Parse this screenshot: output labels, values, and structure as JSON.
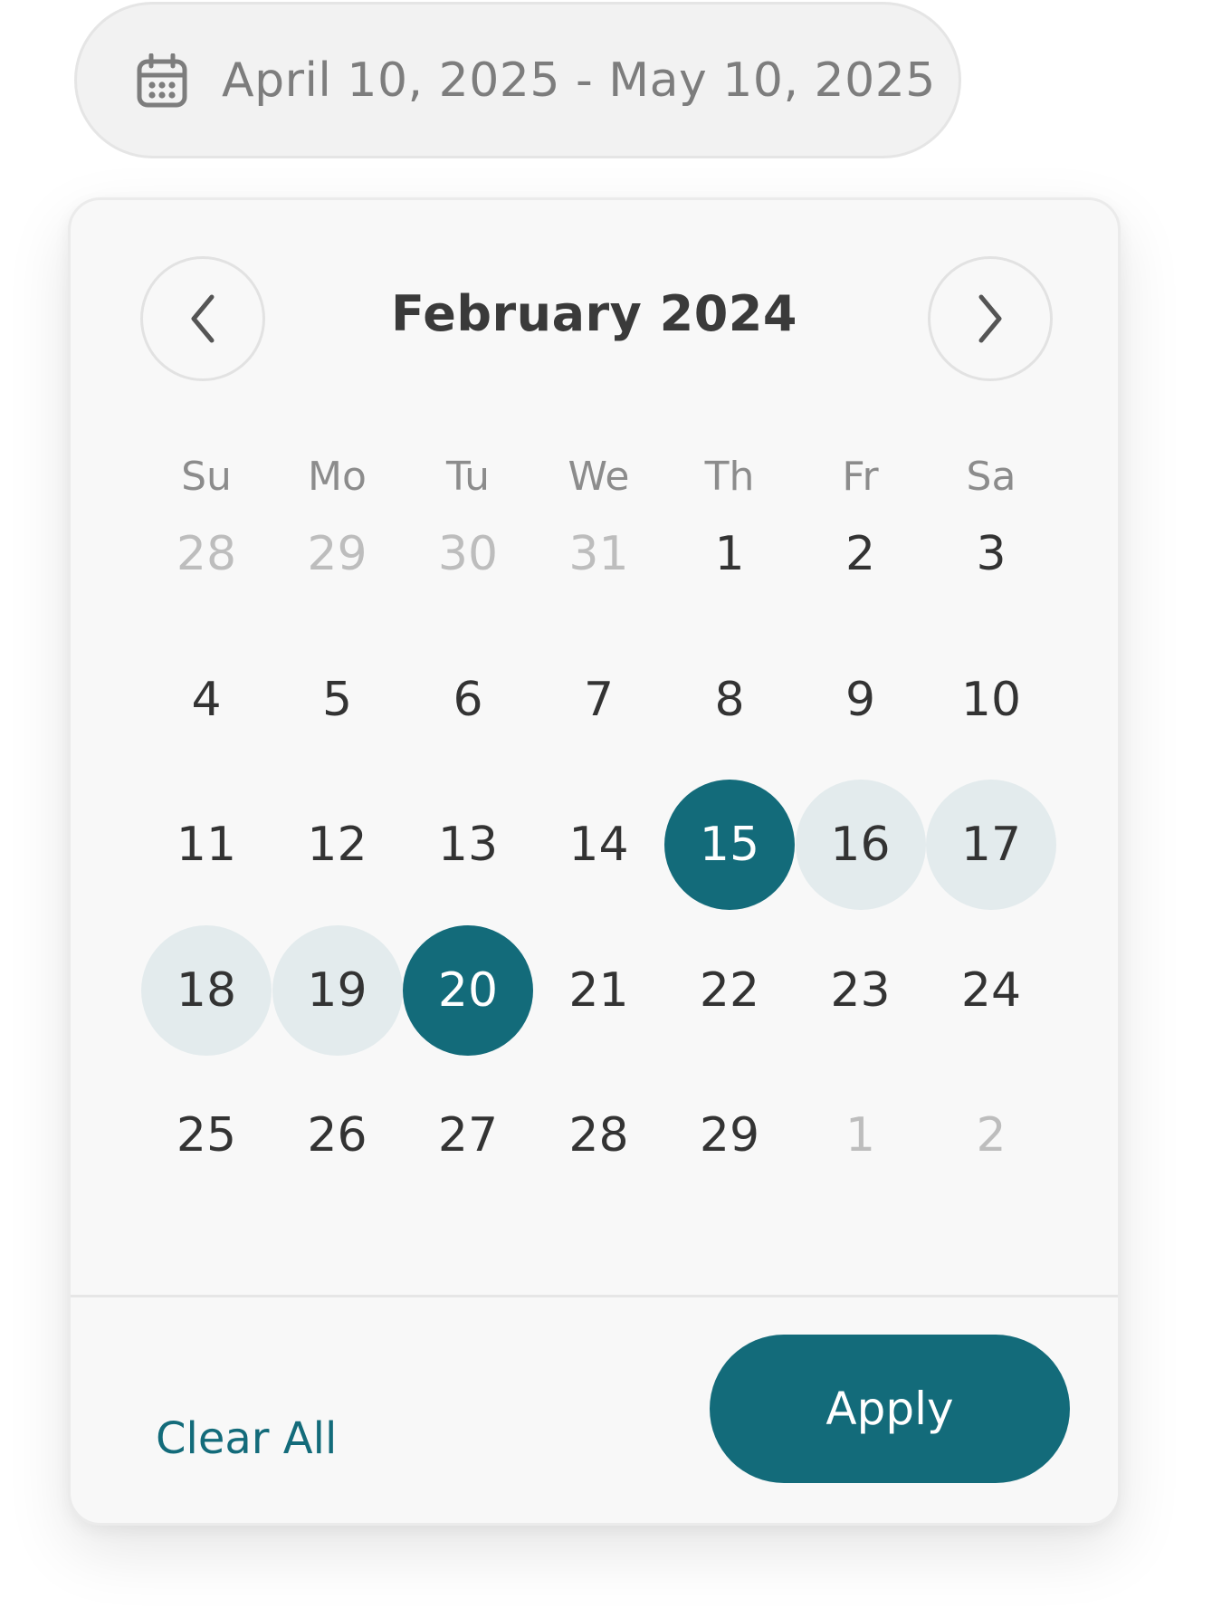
{
  "date_input": {
    "icon": "calendar-icon",
    "value": "April 10, 2025 - May 10, 2025"
  },
  "calendar": {
    "month_title": "February 2024",
    "prev_icon": "chevron-left-icon",
    "next_icon": "chevron-right-icon",
    "weekdays": [
      "Su",
      "Mo",
      "Tu",
      "We",
      "Th",
      "Fr",
      "Sa"
    ],
    "weeks": [
      [
        {
          "label": "28",
          "state": "muted"
        },
        {
          "label": "29",
          "state": "muted"
        },
        {
          "label": "30",
          "state": "muted"
        },
        {
          "label": "31",
          "state": "muted"
        },
        {
          "label": "1",
          "state": "normal"
        },
        {
          "label": "2",
          "state": "normal"
        },
        {
          "label": "3",
          "state": "normal"
        }
      ],
      [
        {
          "label": "4",
          "state": "normal"
        },
        {
          "label": "5",
          "state": "normal"
        },
        {
          "label": "6",
          "state": "normal"
        },
        {
          "label": "7",
          "state": "normal"
        },
        {
          "label": "8",
          "state": "normal"
        },
        {
          "label": "9",
          "state": "normal"
        },
        {
          "label": "10",
          "state": "normal"
        }
      ],
      [
        {
          "label": "11",
          "state": "normal"
        },
        {
          "label": "12",
          "state": "normal"
        },
        {
          "label": "13",
          "state": "normal"
        },
        {
          "label": "14",
          "state": "normal"
        },
        {
          "label": "15",
          "state": "selected"
        },
        {
          "label": "16",
          "state": "in-range"
        },
        {
          "label": "17",
          "state": "in-range"
        }
      ],
      [
        {
          "label": "18",
          "state": "in-range"
        },
        {
          "label": "19",
          "state": "in-range"
        },
        {
          "label": "20",
          "state": "selected"
        },
        {
          "label": "21",
          "state": "normal"
        },
        {
          "label": "22",
          "state": "normal"
        },
        {
          "label": "23",
          "state": "normal"
        },
        {
          "label": "24",
          "state": "normal"
        }
      ],
      [
        {
          "label": "25",
          "state": "normal"
        },
        {
          "label": "26",
          "state": "normal"
        },
        {
          "label": "27",
          "state": "normal"
        },
        {
          "label": "28",
          "state": "normal"
        },
        {
          "label": "29",
          "state": "normal"
        },
        {
          "label": "1",
          "state": "muted"
        },
        {
          "label": "2",
          "state": "muted"
        }
      ]
    ]
  },
  "footer": {
    "clear_label": "Clear All",
    "apply_label": "Apply"
  },
  "colors": {
    "accent": "#136b7a",
    "range_fill": "#e3ebed",
    "muted_text": "#bdbdbd"
  }
}
